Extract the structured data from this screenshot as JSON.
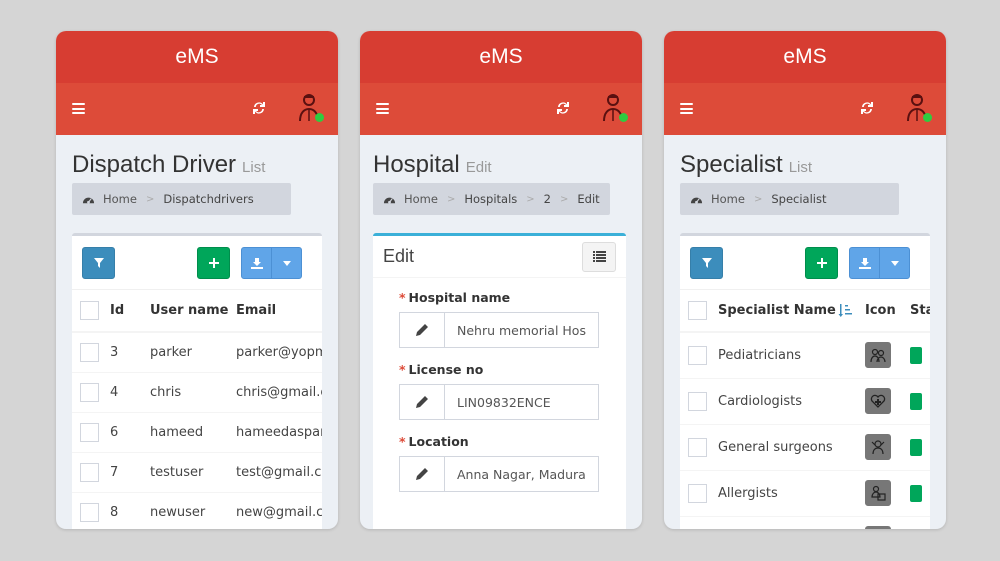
{
  "app": {
    "brand": "eMS"
  },
  "colors": {
    "header": "#d73d32",
    "navbar": "#dd4b39",
    "online": "#2ecc40",
    "add": "#00a65a",
    "filter": "#3c8dbc",
    "export": "#60a5e8",
    "box_info": "#3bb0d8"
  },
  "icons": {
    "menu": "hamburger-icon",
    "refresh": "refresh-icon",
    "avatar": "user-avatar-icon",
    "breadcrumb": "dashboard-icon",
    "filter": "filter-icon",
    "add": "plus-icon",
    "export": "download-icon",
    "caret": "caret-down-icon",
    "edit": "pencil-icon",
    "list": "list-icon",
    "sort": "sort-amount-icon"
  },
  "screens": {
    "dispatch": {
      "title": "Dispatch Driver",
      "subtitle": "List",
      "breadcrumb": [
        "Home",
        "Dispatchdrivers"
      ],
      "columns": [
        "Id",
        "User name",
        "Email"
      ],
      "rows": [
        {
          "id": "3",
          "username": "parker",
          "email": "parker@yopmail.com"
        },
        {
          "id": "4",
          "username": "chris",
          "email": "chris@gmail.com"
        },
        {
          "id": "6",
          "username": "hameed",
          "email": "hameedasparsh@gmail.com"
        },
        {
          "id": "7",
          "username": "testuser",
          "email": "test@gmail.com"
        },
        {
          "id": "8",
          "username": "newuser",
          "email": "new@gmail.com"
        }
      ]
    },
    "hospital": {
      "title": "Hospital",
      "subtitle": "Edit",
      "breadcrumb": [
        "Home",
        "Hospitals",
        "2",
        "Edit"
      ],
      "box_title": "Edit",
      "fields": [
        {
          "label": "Hospital name",
          "value": "Nehru memorial Hospital",
          "required": "*"
        },
        {
          "label": "License no",
          "value": "LIN09832ENCE",
          "required": "*"
        },
        {
          "label": "Location",
          "value": "Anna Nagar, Madurai",
          "required": "*"
        }
      ]
    },
    "specialist": {
      "title": "Specialist",
      "subtitle": "List",
      "breadcrumb": [
        "Home",
        "Specialist"
      ],
      "columns": [
        "Specialist Name",
        "Icon",
        "Status"
      ],
      "rows": [
        {
          "name": "Pediatricians",
          "icon": "pediatrician-icon"
        },
        {
          "name": "Cardiologists",
          "icon": "heart-icon"
        },
        {
          "name": "General surgeons",
          "icon": "surgeon-icon"
        },
        {
          "name": "Allergists",
          "icon": "allergist-icon"
        }
      ]
    }
  }
}
